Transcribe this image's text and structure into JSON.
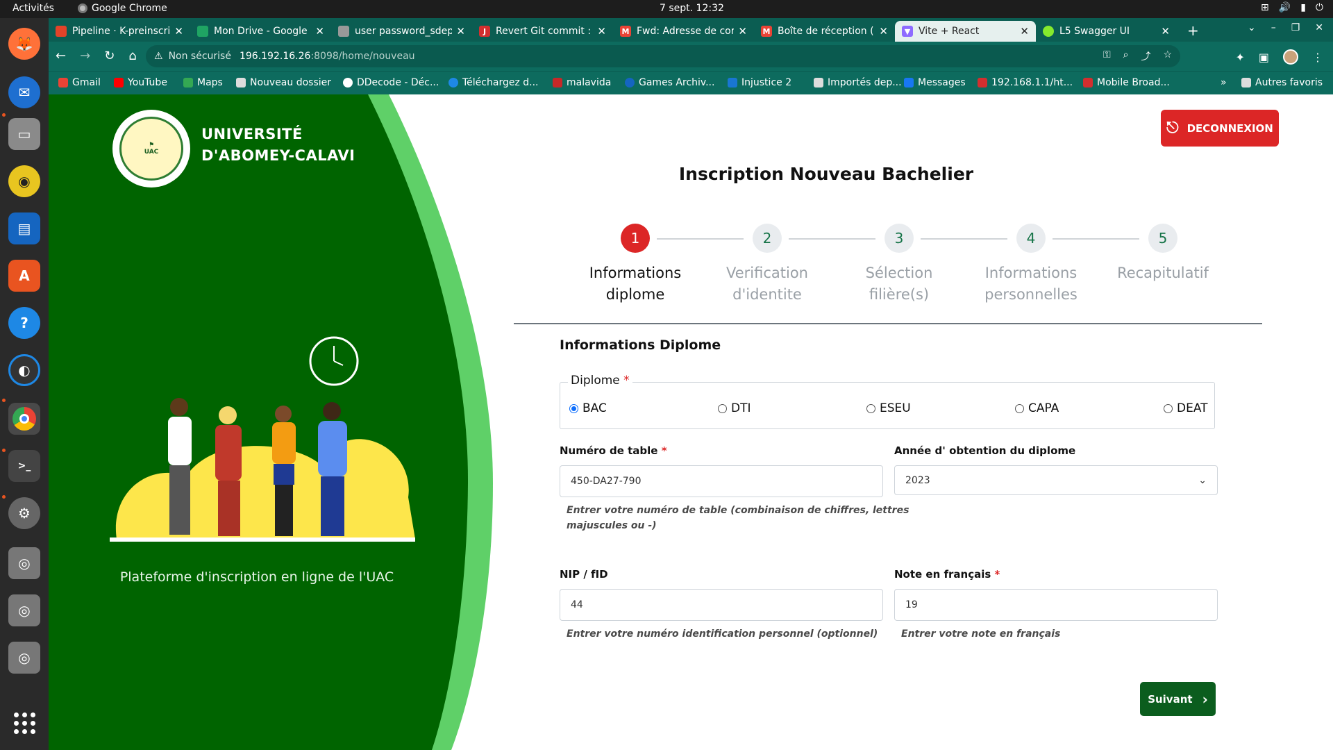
{
  "os": {
    "activities": "Activités",
    "app_name": "Google Chrome",
    "clock": "7 sept.  12:32"
  },
  "browser": {
    "tabs": [
      {
        "title": "Pipeline · K-preinscri",
        "color": "#e24329"
      },
      {
        "title": "Mon Drive - Google D",
        "color": "#1fa463"
      },
      {
        "title": "user password_sdep",
        "color": "#888888"
      },
      {
        "title": "Revert Git commit : r",
        "color": "#d32f2f"
      },
      {
        "title": "Fwd: Adresse de cor",
        "color": "#ea4335"
      },
      {
        "title": "Boîte de réception (",
        "color": "#ea4335"
      },
      {
        "title": "Vite + React",
        "color": "#8e6bff"
      },
      {
        "title": "L5 Swagger UI",
        "color": "#85ea2d"
      }
    ],
    "new_tab": "+",
    "address": {
      "security": "Non sécurisé",
      "host": "196.192.16.26",
      "path": ":8098/home/nouveau"
    },
    "bookmarks": [
      {
        "label": "Gmail",
        "color": "#ea4335"
      },
      {
        "label": "YouTube",
        "color": "#ff0000"
      },
      {
        "label": "Maps",
        "color": "#34a853"
      },
      {
        "label": "Nouveau dossier",
        "color": "#dddddd"
      },
      {
        "label": "DDecode - Déc...",
        "color": "#ffffff"
      },
      {
        "label": "Téléchargez d...",
        "color": "#1e88e5"
      },
      {
        "label": "malavida",
        "color": "#c62828"
      },
      {
        "label": "Games Archiv...",
        "color": "#1565c0"
      },
      {
        "label": "Injustice 2",
        "color": "#1976d2"
      },
      {
        "label": "Importés dep...",
        "color": "#dddddd"
      },
      {
        "label": "Messages",
        "color": "#1877f2"
      },
      {
        "label": "192.168.1.1/ht...",
        "color": "#d32f2f"
      },
      {
        "label": "Mobile Broad...",
        "color": "#d32f2f"
      }
    ],
    "other_bookmarks": "Autres favoris"
  },
  "left_panel": {
    "university_line1": "UNIVERSITÉ",
    "university_line2": "D'ABOMEY-CALAVI",
    "logo_text": "Mens Agitat Molem UNIVERSITE D'ABOMEY-CALAVI",
    "tagline": "Plateforme d'inscription en ligne de l'UAC"
  },
  "header": {
    "logout_label": "DECONNEXION",
    "title": "Inscription Nouveau Bachelier"
  },
  "steps": [
    {
      "number": "1",
      "line1": "Informations",
      "line2": "diplome",
      "active": true
    },
    {
      "number": "2",
      "line1": "Verification",
      "line2": "d'identite",
      "active": false
    },
    {
      "number": "3",
      "line1": "Sélection",
      "line2": "filière(s)",
      "active": false
    },
    {
      "number": "4",
      "line1": "Informations",
      "line2": "personnelles",
      "active": false
    },
    {
      "number": "5",
      "line1": "Recapitulatif",
      "line2": "",
      "active": false
    }
  ],
  "form": {
    "section_title": "Informations Diplome",
    "diploma_legend": "Diplome",
    "required_mark": "*",
    "diploma_options": [
      "BAC",
      "DTI",
      "ESEU",
      "CAPA",
      "DEAT"
    ],
    "diploma_selected": "BAC",
    "table_number_label": "Numéro de table",
    "table_number_value": "450-DA27-790",
    "table_number_help_1": "Entrer votre numéro de table (combinaison de chiffres, lettres",
    "table_number_help_2": "majuscules ou -)",
    "year_label": "Année d' obtention du diplome",
    "year_value": "2023",
    "nip_label": "NIP / fID",
    "nip_value": "44",
    "nip_help": "Entrer votre numéro identification personnel (optionnel)",
    "french_label": "Note en français",
    "french_value": "19",
    "french_help": "Entrer votre note en français",
    "next_label": "Suivant"
  },
  "colors": {
    "brand_green": "#006400",
    "accent_green": "#5fd068",
    "danger_red": "#dc2626",
    "chrome_teal": "#0d6b5e"
  }
}
